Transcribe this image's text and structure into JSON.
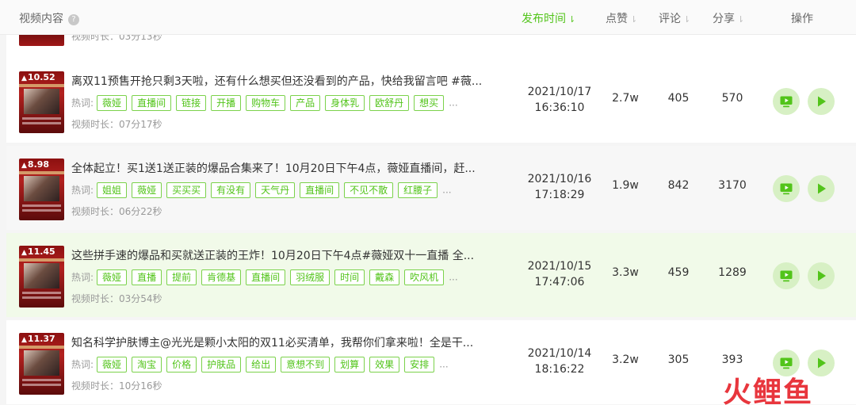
{
  "header": {
    "content_label": "视频内容",
    "help_icon_text": "?",
    "publish_time_label": "发布时间",
    "likes_label": "点赞",
    "comments_label": "评论",
    "shares_label": "分享",
    "actions_label": "操作",
    "sort_arrow": "⇂"
  },
  "partial_row": {
    "duration_text": "视频时长：03分13秒"
  },
  "keyword_label": "热词:",
  "more": "...",
  "videos": [
    {
      "thumb_likes": "10.52",
      "title": "离双11预售开抢只剩3天啦，还有什么想买但还没看到的产品，快给我留言吧 #薇...",
      "tags": [
        "薇娅",
        "直播间",
        "链接",
        "开播",
        "购物车",
        "产品",
        "身体乳",
        "欧舒丹",
        "想买"
      ],
      "duration": "视频时长：07分17秒",
      "date": "2021/10/17",
      "time": "16:36:10",
      "likes": "2.7w",
      "comments": "405",
      "shares": "570"
    },
    {
      "thumb_likes": "8.98",
      "title": "全体起立！买1送1送正装的爆品合集来了！10月20日下午4点，薇娅直播间，赶...",
      "tags": [
        "姐姐",
        "薇娅",
        "买买买",
        "有没有",
        "天气丹",
        "直播间",
        "不见不散",
        "红腰子"
      ],
      "duration": "视频时长：06分22秒",
      "date": "2021/10/16",
      "time": "17:18:29",
      "likes": "1.9w",
      "comments": "842",
      "shares": "3170"
    },
    {
      "thumb_likes": "11.45",
      "title": "这些拼手速的爆品和买就送正装的王炸！10月20日下午4点#薇娅双十一直播 全...",
      "tags": [
        "薇娅",
        "直播",
        "提前",
        "肯德基",
        "直播间",
        "羽绒服",
        "时间",
        "戴森",
        "吹风机"
      ],
      "duration": "视频时长：03分54秒",
      "date": "2021/10/15",
      "time": "17:47:06",
      "likes": "3.3w",
      "comments": "459",
      "shares": "1289"
    },
    {
      "thumb_likes": "11.37",
      "title": "知名科学护肤博主@光光是颗小太阳的双11必买清单，我帮你们拿来啦！全是干...",
      "tags": [
        "薇娅",
        "淘宝",
        "价格",
        "护肤品",
        "给出",
        "意想不到",
        "划算",
        "效果",
        "安排"
      ],
      "duration": "视频时长：10分16秒",
      "date": "2021/10/14",
      "time": "18:16:22",
      "likes": "3.2w",
      "comments": "305",
      "shares": "393"
    }
  ],
  "icons": {
    "tv_button": "tv-icon",
    "play_button": "play-icon",
    "accent": "#52c41a",
    "button_bg": "#d7f0c4"
  },
  "watermark": "火鲤鱼"
}
